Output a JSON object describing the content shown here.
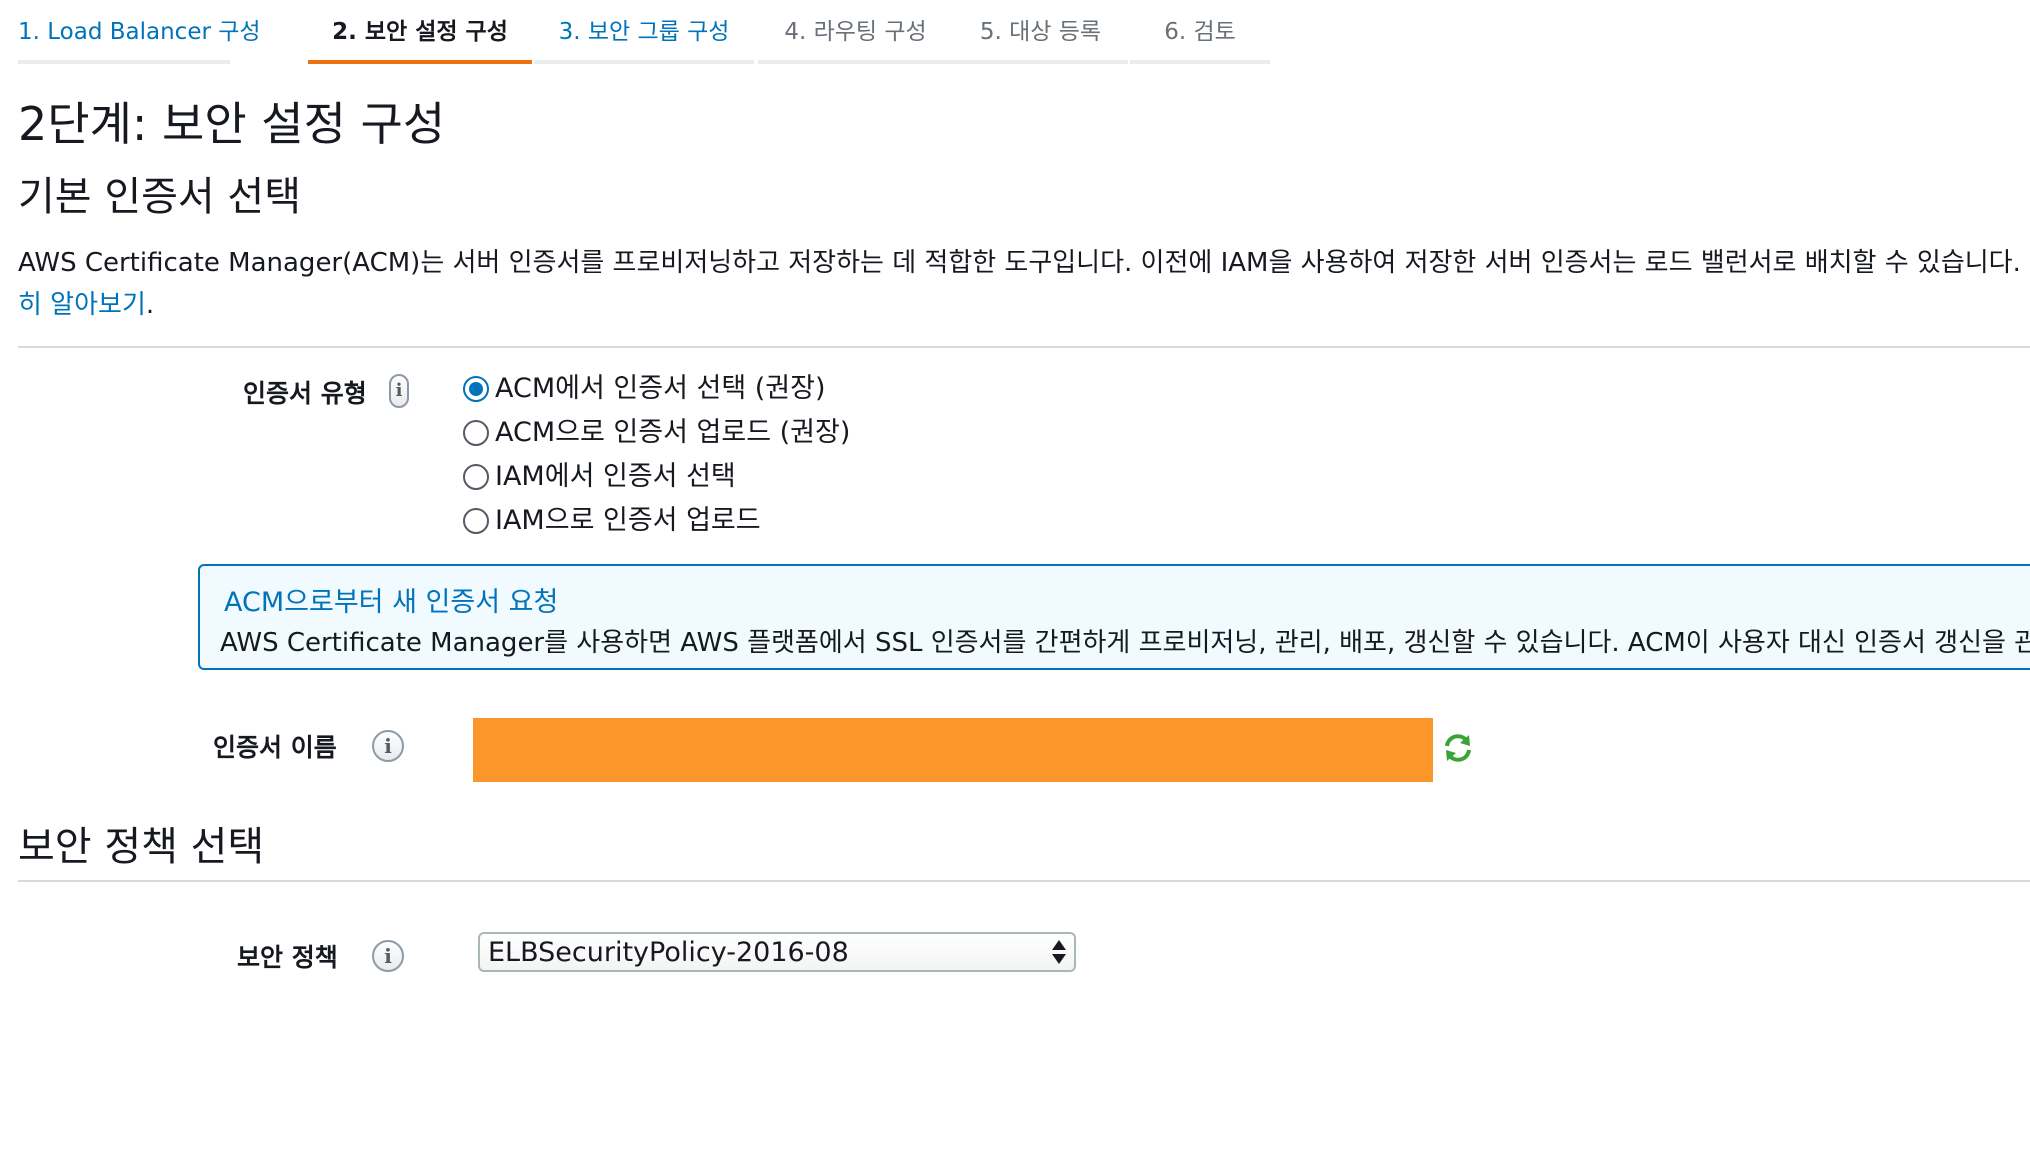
{
  "wizard": {
    "tabs": [
      {
        "label": "1. Load Balancer 구성",
        "state": "link"
      },
      {
        "label": "2. 보안 설정 구성",
        "state": "active"
      },
      {
        "label": "3. 보안 그룹 구성",
        "state": "link"
      },
      {
        "label": "4. 라우팅 구성",
        "state": "muted"
      },
      {
        "label": "5. 대상 등록",
        "state": "muted"
      },
      {
        "label": "6. 검토",
        "state": "muted"
      }
    ]
  },
  "page_title": "2단계: 보안 설정 구성",
  "certificate_section": {
    "heading": "기본 인증서 선택",
    "description_line1": "AWS Certificate Manager(ACM)는 서버 인증서를 프로비저닝하고 저장하는 데 적합한 도구입니다. 이전에 IAM을 사용하여 저장한 서버 인증서는 로드 밸런서로 배치할 수 있습니다.",
    "learn_more": "히 알아보기",
    "learn_more_suffix": ".",
    "cert_type_label": "인증서 유형",
    "cert_type_options": [
      {
        "label": "ACM에서 인증서 선택 (권장)",
        "checked": true
      },
      {
        "label": "ACM으로 인증서 업로드 (권장)",
        "checked": false
      },
      {
        "label": "IAM에서 인증서 선택",
        "checked": false
      },
      {
        "label": "IAM으로 인증서 업로드",
        "checked": false
      }
    ],
    "info_box": {
      "title": "ACM으로부터 새 인증서 요청",
      "text": "AWS Certificate Manager를 사용하면 AWS 플랫폼에서 SSL 인증서를 간편하게 프로비저닝, 관리, 배포, 갱신할 수 있습니다. ACM이 사용자 대신 인증서 갱신을 관"
    },
    "cert_name_label": "인증서 이름",
    "cert_name_value": ""
  },
  "policy_section": {
    "heading": "보안 정책 선택",
    "policy_label": "보안 정책",
    "selected_policy": "ELBSecurityPolicy-2016-08"
  },
  "colors": {
    "link": "#0073bb",
    "active_tab_underline": "#ec7211",
    "redaction": "#fd962a",
    "info_box_border": "#0073bb",
    "refresh_icon": "#3aa335"
  },
  "icons": [
    "info-icon",
    "refresh-icon",
    "select-caret-icon"
  ]
}
